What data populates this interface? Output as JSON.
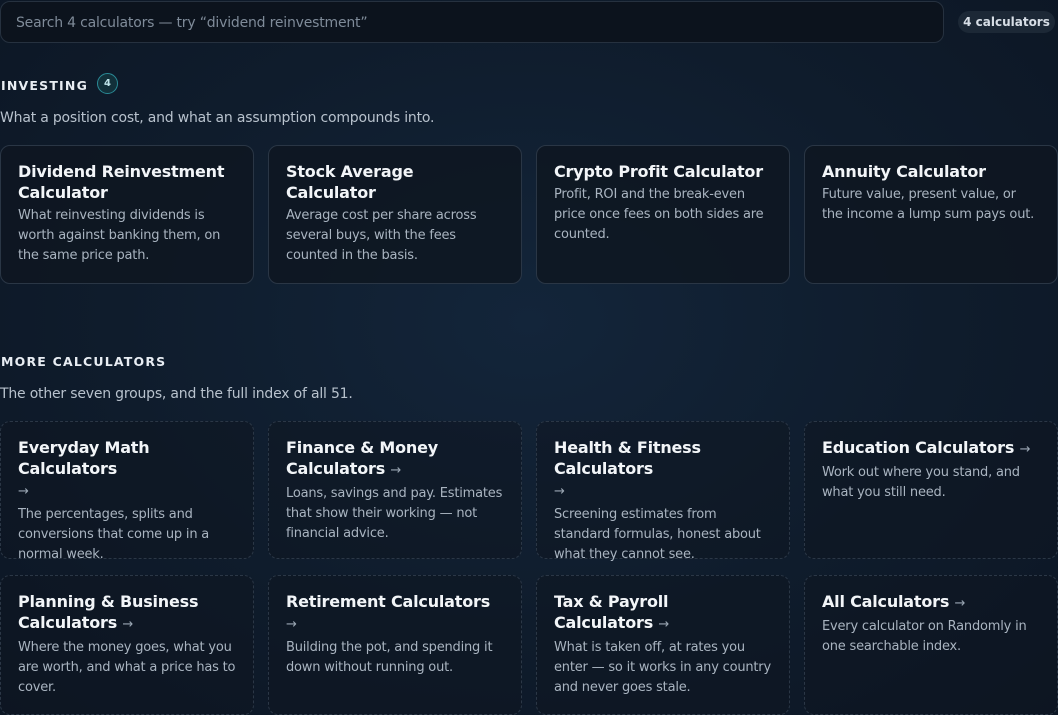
{
  "search": {
    "placeholder": "Search 4 calculators — try “dividend reinvestment”",
    "count_label": "4 calculators"
  },
  "investing": {
    "heading": "INVESTING",
    "count": "4",
    "description": "What a position cost, and what an assumption compounds into.",
    "cards": [
      {
        "title": "Dividend Reinvestment Calculator",
        "description": "What reinvesting dividends is worth against banking them, on the same price path."
      },
      {
        "title": "Stock Average Calculator",
        "description": "Average cost per share across several buys, with the fees counted in the basis."
      },
      {
        "title": "Crypto Profit Calculator",
        "description": "Profit, ROI and the break-even price once fees on both sides are counted."
      },
      {
        "title": "Annuity Calculator",
        "description": "Future value, present value, or the income a lump sum pays out."
      }
    ]
  },
  "more": {
    "heading": "MORE CALCULATORS",
    "description": "The other seven groups, and the full index of all 51.",
    "arrow": "→",
    "cards": [
      {
        "title": "Everyday Math Calculators",
        "description": "The percentages, splits and conversions that come up in a normal week."
      },
      {
        "title": "Finance & Money Calculators",
        "description": "Loans, savings and pay. Estimates that show their working — not financial advice."
      },
      {
        "title": "Health & Fitness Calculators",
        "description": "Screening estimates from standard formulas, honest about what they cannot see."
      },
      {
        "title": "Education Calculators",
        "description": "Work out where you stand, and what you still need."
      },
      {
        "title": "Planning & Business Calculators",
        "description": "Where the money goes, what you are worth, and what a price has to cover."
      },
      {
        "title": "Retirement Calculators",
        "description": "Building the pot, and spending it down without running out."
      },
      {
        "title": "Tax & Payroll Calculators",
        "description": "What is taken off, at rates you enter — so it works in any country and never goes stale."
      },
      {
        "title": "All Calculators",
        "description": "Every calculator on Randomly in one searchable index."
      }
    ]
  }
}
